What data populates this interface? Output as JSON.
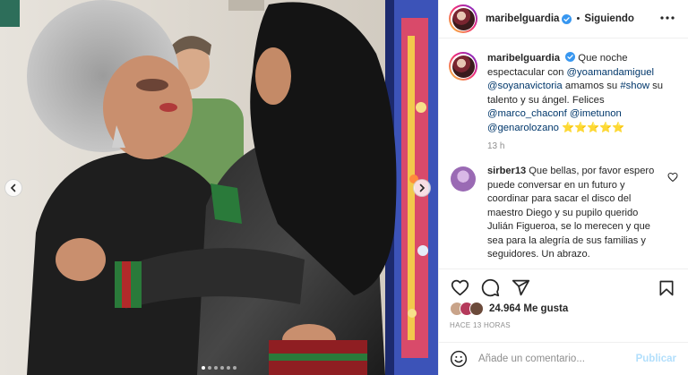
{
  "header": {
    "username": "maribelguardia",
    "separator": "•",
    "follow_label": "Siguiendo"
  },
  "caption": {
    "username": "maribelguardia",
    "t1": "Que noche espectacular con",
    "mention1": "@yoamandamiguel",
    "mention2": "@soyanavictoria",
    "t2": "amamos su",
    "hashtag": "#show",
    "t3": "su talento y su ángel. Felices",
    "mention3": "@marco_chaconf",
    "mention4": "@imetunon",
    "mention5": "@genarolozano",
    "stars": "⭐⭐⭐⭐⭐",
    "time": "13 h"
  },
  "comment": {
    "username": "sirber13",
    "text": "Que bellas, por favor espero puede conversar en un futuro y coordinar para sacar el disco del maestro Diego y su pupilo querido Julián Figueroa, se lo merecen y que sea para la alegría de sus familias y seguidores. Un abrazo."
  },
  "likes": {
    "count": "24.964",
    "label": "Me gusta",
    "ago": "HACE 13 HORAS"
  },
  "add_comment": {
    "placeholder": "Añade un comentario...",
    "post_label": "Publicar"
  },
  "carousel": {
    "slides": 6,
    "active": 1
  },
  "colors": {
    "verified": "#3897f0",
    "link": "#00376b",
    "muted": "#8e8e8e",
    "post_disabled": "#b2dffc",
    "star": "#f0b400"
  },
  "icons": [
    "more-icon",
    "verified-icon",
    "heart-icon",
    "comment-icon",
    "share-icon",
    "bookmark-icon",
    "emoji-icon",
    "chevron-left-icon",
    "chevron-right-icon"
  ]
}
